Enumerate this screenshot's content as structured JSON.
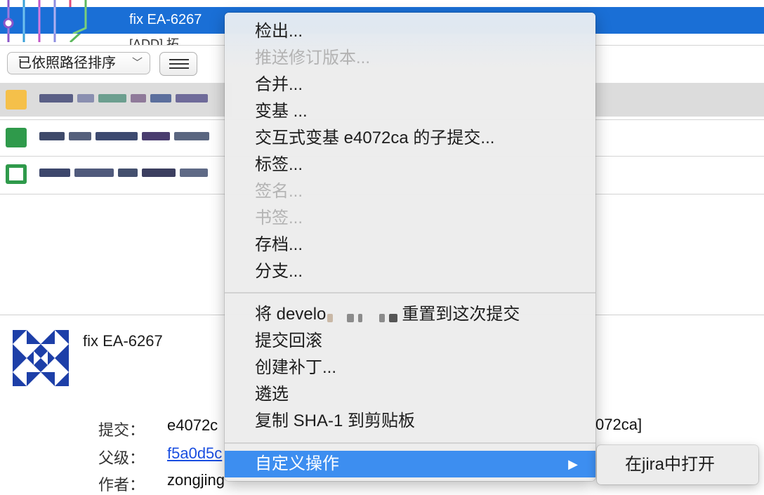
{
  "commit_list": {
    "selected_commit_message": "fix EA-6267",
    "next_commit_peek": "[ADD] 拓   "
  },
  "toolbar": {
    "sort_select": "已依照路径排序",
    "view_toggle_icon": "list-icon"
  },
  "detail": {
    "commit_title": "fix EA-6267",
    "labels": {
      "commit": "提交：",
      "parent": "父级：",
      "author": "作者："
    },
    "commit_value": "e4072c",
    "commit_value_tail": "072ca]",
    "parent_value": "f5a0d5c",
    "author_value": "zongjing"
  },
  "context_menu": {
    "items": [
      {
        "label": "检出...",
        "enabled": true
      },
      {
        "label": "推送修订版本...",
        "enabled": false
      },
      {
        "label": "合并...",
        "enabled": true
      },
      {
        "label": "变基 ...",
        "enabled": true
      },
      {
        "label": "交互式变基 e4072ca 的子提交...",
        "enabled": true
      },
      {
        "label": "标签...",
        "enabled": true
      },
      {
        "label": "签名...",
        "enabled": false
      },
      {
        "label": "书签...",
        "enabled": false
      },
      {
        "label": "存档...",
        "enabled": true
      },
      {
        "label": "分支...",
        "enabled": true
      }
    ],
    "reset_prefix": "将 develo",
    "reset_suffix": "重置到这次提交",
    "items2": [
      {
        "label": "提交回滚"
      },
      {
        "label": "创建补丁..."
      },
      {
        "label": "遴选"
      },
      {
        "label": "复制 SHA-1 到剪贴板"
      }
    ],
    "custom_actions": "自定义操作",
    "submenu_arrow": "▶"
  },
  "submenu": {
    "item": "在jira中打开"
  },
  "colors": {
    "selection_blue": "#1a6fd6",
    "menu_highlight": "#3d8ef0",
    "link_blue": "#1a4ee0",
    "disabled_text": "#b3b3b3"
  }
}
